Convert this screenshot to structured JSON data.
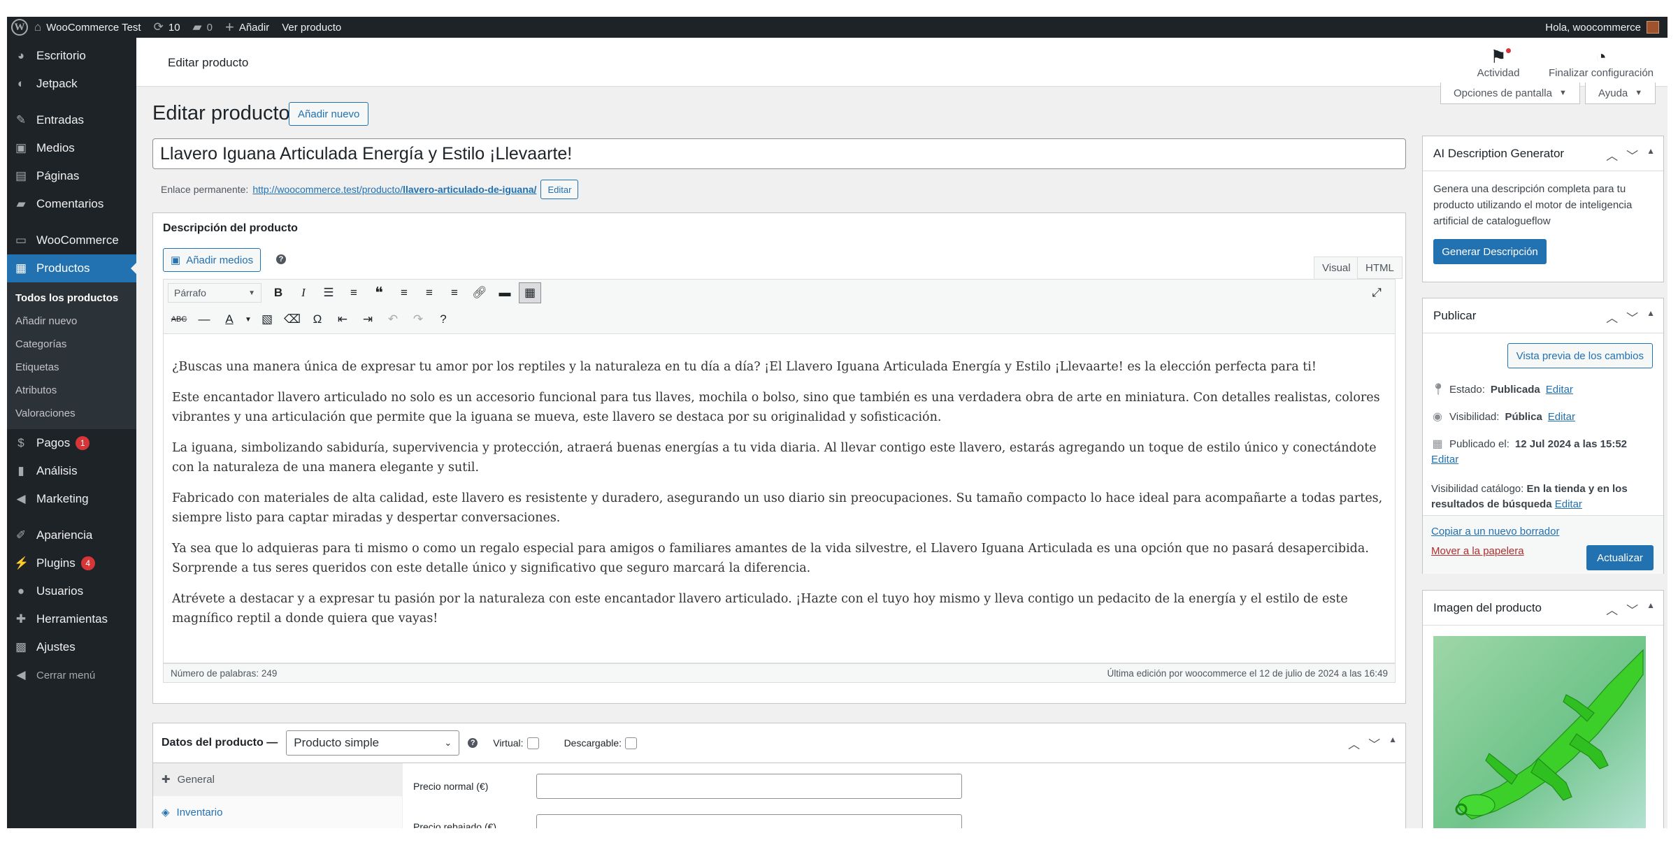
{
  "admin_bar": {
    "site_name": "WooCommerce Test",
    "updates_count": "10",
    "comments_count": "0",
    "add_new": "Añadir",
    "view_product": "Ver producto",
    "greeting": "Hola, woocommerce"
  },
  "sidebar": {
    "items": [
      {
        "label": "Escritorio",
        "icon": "dashboard-icon"
      },
      {
        "label": "Jetpack",
        "icon": "jetpack-icon"
      },
      {
        "label": "Entradas",
        "icon": "pin-icon"
      },
      {
        "label": "Medios",
        "icon": "media-icon"
      },
      {
        "label": "Páginas",
        "icon": "page-icon"
      },
      {
        "label": "Comentarios",
        "icon": "comment-icon"
      },
      {
        "label": "WooCommerce",
        "icon": "woo-icon"
      },
      {
        "label": "Productos",
        "icon": "archive-icon"
      },
      {
        "label": "Pagos",
        "icon": "dollar-icon",
        "badge": "1"
      },
      {
        "label": "Análisis",
        "icon": "chart-icon"
      },
      {
        "label": "Marketing",
        "icon": "megaphone-icon"
      },
      {
        "label": "Apariencia",
        "icon": "brush-icon"
      },
      {
        "label": "Plugins",
        "icon": "plugin-icon",
        "badge": "4"
      },
      {
        "label": "Usuarios",
        "icon": "user-icon"
      },
      {
        "label": "Herramientas",
        "icon": "wrench-icon"
      },
      {
        "label": "Ajustes",
        "icon": "settings-icon"
      },
      {
        "label": "Cerrar menú",
        "icon": "collapse-icon"
      }
    ],
    "submenu": [
      "Todos los productos",
      "Añadir nuevo",
      "Categorías",
      "Etiquetas",
      "Atributos",
      "Valoraciones"
    ]
  },
  "header": {
    "title": "Editar producto",
    "activity": "Actividad",
    "finish_setup": "Finalizar configuración"
  },
  "screen_options": "Opciones de pantalla",
  "help": "Ayuda",
  "page": {
    "heading": "Editar producto",
    "add_new": "Añadir nuevo",
    "product_title": "Llavero Iguana Articulada Energía y Estilo ¡Llevaarte!",
    "permalink_label": "Enlace permanente:",
    "permalink_base": "http://woocommerce.test/producto/",
    "permalink_slug": "llavero-articulado-de-iguana/",
    "permalink_edit": "Editar"
  },
  "description": {
    "box_title": "Descripción del producto",
    "add_media": "Añadir medios",
    "tab_visual": "Visual",
    "tab_html": "HTML",
    "format": "Párrafo",
    "paragraphs": [
      "¿Buscas una manera única de expresar tu amor por los reptiles y la naturaleza en tu día a día? ¡El Llavero Iguana Articulada Energía y Estilo ¡Llevaarte! es la elección perfecta para ti!",
      "Este encantador llavero articulado no solo es un accesorio funcional para tus llaves, mochila o bolso, sino que también es una verdadera obra de arte en miniatura. Con detalles realistas, colores vibrantes y una articulación que permite que la iguana se mueva, este llavero se destaca por su originalidad y sofisticación.",
      "La iguana, simbolizando sabiduría, supervivencia y protección, atraerá buenas energías a tu vida diaria. Al llevar contigo este llavero, estarás agregando un toque de estilo único y conectándote con la naturaleza de una manera elegante y sutil.",
      "Fabricado con materiales de alta calidad, este llavero es resistente y duradero, asegurando un uso diario sin preocupaciones. Su tamaño compacto lo hace ideal para acompañarte a todas partes, siempre listo para captar miradas y despertar conversaciones.",
      "Ya sea que lo adquieras para ti mismo o como un regalo especial para amigos o familiares amantes de la vida silvestre, el Llavero Iguana Articulada es una opción que no pasará desapercibida. Sorprende a tus seres queridos con este detalle único y significativo que seguro marcará la diferencia.",
      "Atrévete a destacar y a expresar tu pasión por la naturaleza con este encantador llavero articulado. ¡Hazte con el tuyo hoy mismo y lleva contigo un pedacito de la energía y el estilo de este magnífico reptil a donde quiera que vayas!"
    ],
    "word_count": "Número de palabras: 249",
    "last_edit": "Última edición por woocommerce el 12 de julio de 2024 a las 16:49"
  },
  "product_data": {
    "label": "Datos del producto —",
    "type": "Producto simple",
    "virtual": "Virtual:",
    "downloadable": "Descargable:",
    "tabs": [
      "General",
      "Inventario"
    ],
    "regular_price": "Precio normal (€)",
    "sale_price": "Precio rebajado (€)"
  },
  "ai_box": {
    "title": "AI Description Generator",
    "text": "Genera una descripción completa para tu producto utilizando el motor de inteligencia artificial de catalogueflow",
    "button": "Generar Descripción"
  },
  "publish": {
    "title": "Publicar",
    "preview": "Vista previa de los cambios",
    "status_label": "Estado:",
    "status_value": "Publicada",
    "visibility_label": "Visibilidad:",
    "visibility_value": "Pública",
    "published_label": "Publicado el:",
    "published_value": "12 Jul 2024 a las 15:52",
    "edit": "Editar",
    "catalog_label": "Visibilidad catálogo:",
    "catalog_value_1": "En la tienda y en los",
    "catalog_value_2": "resultados de búsqueda",
    "copy_draft": "Copiar a un nuevo borrador",
    "trash": "Mover a la papelera",
    "update": "Actualizar"
  },
  "image_box": {
    "title": "Imagen del producto"
  }
}
